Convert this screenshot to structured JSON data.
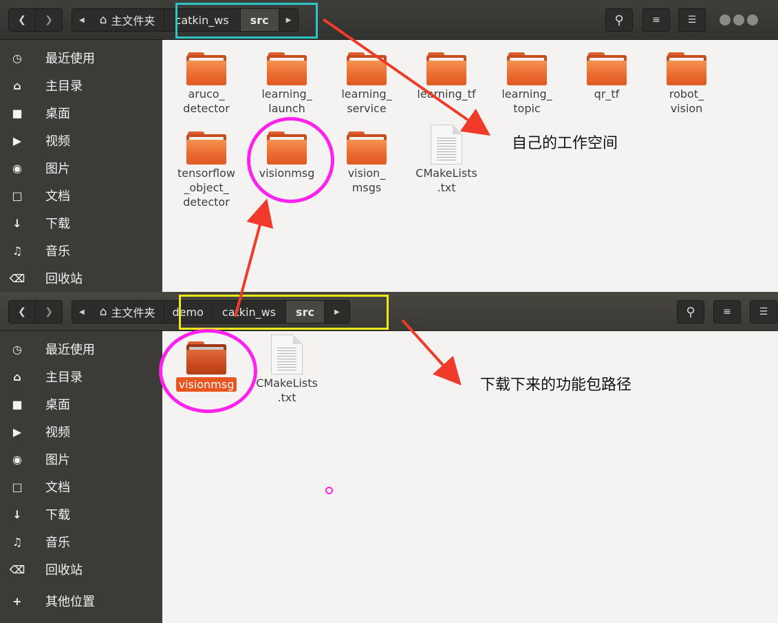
{
  "top_window": {
    "home_label": "主文件夹",
    "path": [
      "catkin_ws",
      "src"
    ],
    "sidebar": [
      "最近使用",
      "主目录",
      "桌面",
      "视频",
      "图片",
      "文档",
      "下载",
      "音乐",
      "回收站"
    ],
    "items": [
      {
        "label": "aruco_\ndetector",
        "type": "folder"
      },
      {
        "label": "learning_\nlaunch",
        "type": "folder"
      },
      {
        "label": "learning_\nservice",
        "type": "folder"
      },
      {
        "label": "learning_tf",
        "type": "folder"
      },
      {
        "label": "learning_\ntopic",
        "type": "folder"
      },
      {
        "label": "qr_tf",
        "type": "folder"
      },
      {
        "label": "robot_\nvision",
        "type": "folder"
      },
      {
        "label": "tensorflow\n_object_\ndetector",
        "type": "folder"
      },
      {
        "label": "visionmsg",
        "type": "folder"
      },
      {
        "label": "vision_\nmsgs",
        "type": "folder"
      },
      {
        "label": "CMakeLists\n.txt",
        "type": "file"
      }
    ],
    "annotation": "自己的工作空间"
  },
  "bottom_window": {
    "home_label": "主文件夹",
    "path": [
      "demo",
      "catkin_ws",
      "src"
    ],
    "sidebar": [
      "最近使用",
      "主目录",
      "桌面",
      "视频",
      "图片",
      "文档",
      "下载",
      "音乐",
      "回收站",
      "其他位置"
    ],
    "items": [
      {
        "label": "visionmsg",
        "type": "folder",
        "selected": true
      },
      {
        "label": "CMakeLists\n.txt",
        "type": "file"
      }
    ],
    "annotation": "下载下来的功能包路径"
  },
  "colors": {
    "highlight_cyan": "#2ec4c8",
    "highlight_yellow": "#f2ea16",
    "circle_magenta": "#ff22ee",
    "arrow_red": "#f03a2a",
    "folder_orange": "#e9692f",
    "sidebar_bg": "#3c3b37"
  }
}
